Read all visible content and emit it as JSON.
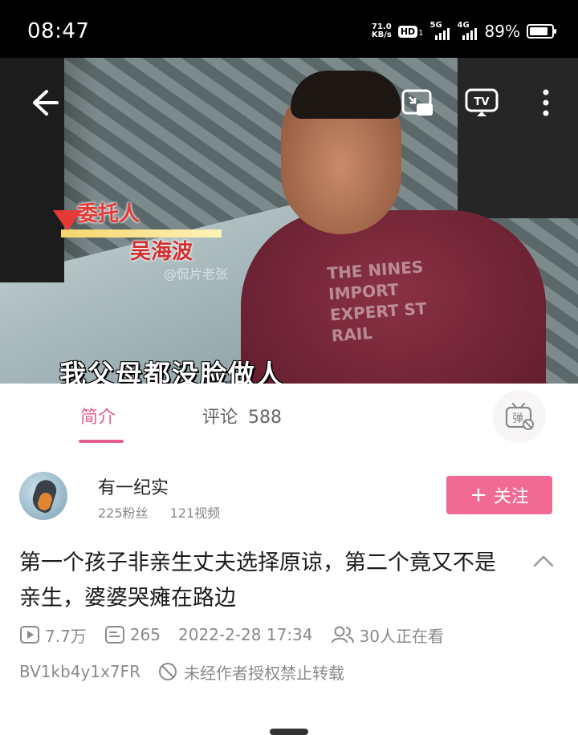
{
  "status_bar": {
    "time": "08:47",
    "net_speed_value": "71.0",
    "net_speed_unit": "KB/s",
    "hd_label": "HD",
    "hd_sub": "1",
    "signal1_label": "5G",
    "signal2_label": "4G",
    "battery": "89%"
  },
  "video": {
    "nameplate_role": "委托人",
    "nameplate_name": "吴海波",
    "watermark": "@侃片老张",
    "subtitle": "我父母都没脸做人",
    "shirt_text": "THE NINES IMPORT EXPERT ST RAIL",
    "icons": {
      "back": "back-arrow-icon",
      "pip": "picture-in-picture-icon",
      "cast": "tv-cast-icon",
      "more": "more-vertical-icon"
    }
  },
  "tabs": {
    "intro_label": "简介",
    "comments_label": "评论",
    "comments_count": "588",
    "danmaku_label": "弹"
  },
  "uploader": {
    "name": "有一纪实",
    "fans": "225粉丝",
    "videos": "121视频",
    "follow_plus": "+",
    "follow_label": "关注"
  },
  "video_info": {
    "title": "第一个孩子非亲生丈夫选择原谅，第二个竟又不是亲生，婆婆哭瘫在路边",
    "views": "7.7万",
    "danmaku_count": "265",
    "datetime": "2022-2-28 17:34",
    "watching": "30人正在看",
    "bvid": "BV1kb4y1x7FR",
    "notice": "未经作者授权禁止转载"
  },
  "colors": {
    "accent": "#e4608a",
    "follow_bg": "#f06a93",
    "meta_gray": "#8a8a8a"
  }
}
